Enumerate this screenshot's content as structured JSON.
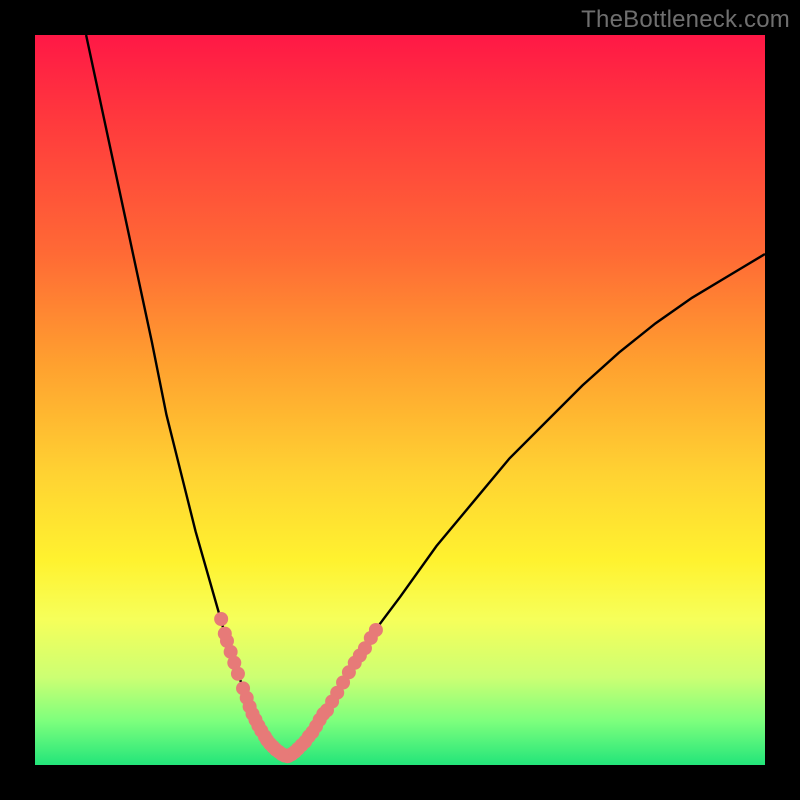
{
  "watermark": "TheBottleneck.com",
  "colors": {
    "bg": "#000000",
    "curve": "#000000",
    "marker": "#e77a78",
    "grad_top": "#ff1846",
    "grad_bottom": "#23e57a"
  },
  "chart_data": {
    "type": "line",
    "title": "",
    "xlabel": "",
    "ylabel": "",
    "xlim": [
      0,
      100
    ],
    "ylim": [
      0,
      100
    ],
    "curve_left": {
      "x": [
        7,
        10,
        13,
        16,
        18,
        20,
        22,
        24,
        26,
        28,
        29,
        30,
        31,
        32,
        33,
        34
      ],
      "y": [
        100,
        86,
        72,
        58,
        48,
        40,
        32,
        25,
        18,
        12,
        9,
        6.5,
        4.5,
        3,
        2,
        1.2
      ]
    },
    "curve_right": {
      "x": [
        34,
        35,
        36,
        37,
        38,
        40,
        42,
        44,
        47,
        50,
        55,
        60,
        65,
        70,
        75,
        80,
        85,
        90,
        95,
        100
      ],
      "y": [
        1.2,
        1.5,
        2.2,
        3.2,
        4.5,
        7.5,
        11,
        14.5,
        19,
        23,
        30,
        36,
        42,
        47,
        52,
        56.5,
        60.5,
        64,
        67,
        70
      ]
    },
    "markers_left": {
      "x": [
        25.5,
        26,
        26.3,
        26.8,
        27.3,
        27.8,
        28.5,
        29,
        29.4,
        29.8,
        30.2,
        30.6,
        31,
        31.5,
        31.8,
        32.2,
        32.6,
        33,
        33.4,
        33.8,
        34.2,
        34.6
      ],
      "y": [
        20,
        18,
        17,
        15.5,
        14,
        12.5,
        10.5,
        9.2,
        8,
        7,
        6.2,
        5.4,
        4.7,
        3.9,
        3.4,
        2.9,
        2.5,
        2.1,
        1.8,
        1.5,
        1.3,
        1.2
      ]
    },
    "markers_right": {
      "x": [
        34.8,
        35.2,
        35.6,
        36,
        36.5,
        37,
        37.5,
        38,
        38.5,
        39,
        39.5,
        40,
        40.7,
        41.4,
        42.2,
        43,
        43.8,
        44.5,
        45.2,
        46,
        46.7
      ],
      "y": [
        1.3,
        1.5,
        1.8,
        2.2,
        2.7,
        3.2,
        3.9,
        4.5,
        5.3,
        6.2,
        7,
        7.5,
        8.7,
        9.9,
        11.3,
        12.7,
        14,
        15,
        16,
        17.4,
        18.5
      ]
    }
  }
}
